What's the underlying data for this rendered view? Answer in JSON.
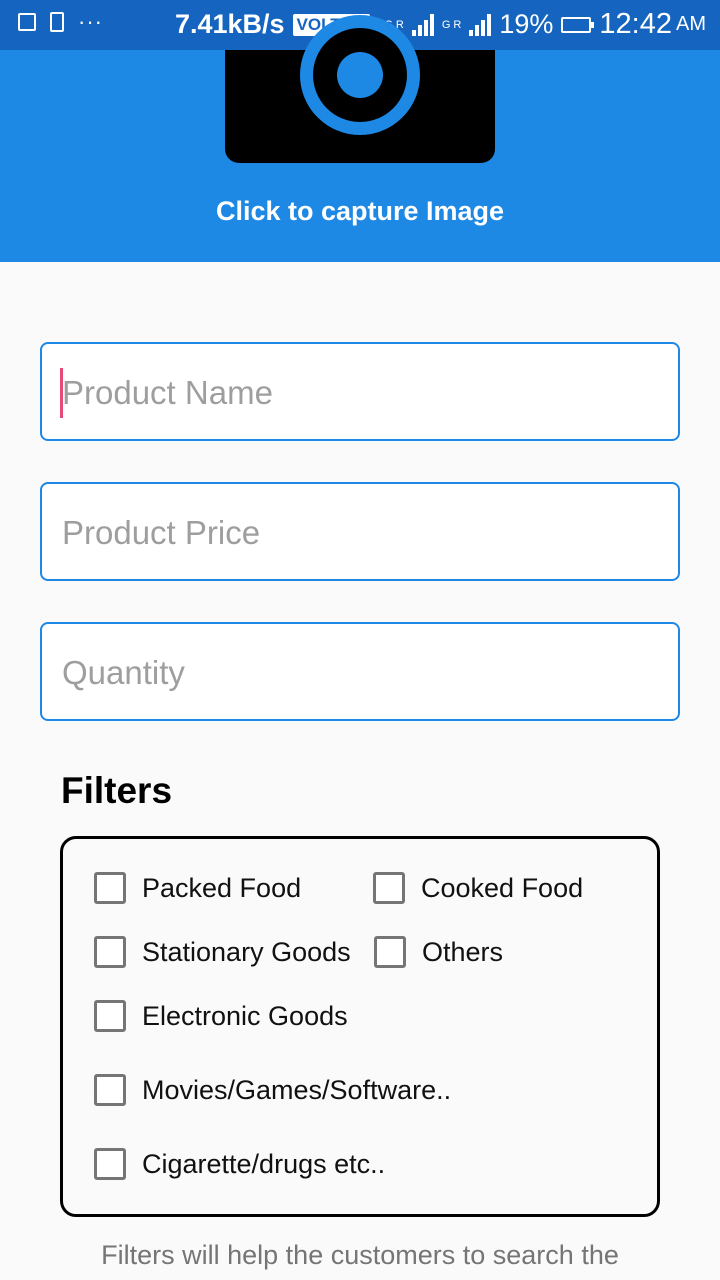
{
  "status_bar": {
    "speed": "7.41kB/s",
    "volte": "VOLTE 1",
    "net1": "4G R",
    "net2": "G R",
    "battery": "19%",
    "time": "12:42",
    "ampm": "AM"
  },
  "header": {
    "capture_label": "Click to capture Image"
  },
  "form": {
    "product_name": {
      "placeholder": "Product Name",
      "value": ""
    },
    "product_price": {
      "placeholder": "Product Price",
      "value": ""
    },
    "quantity": {
      "placeholder": "Quantity",
      "value": ""
    }
  },
  "filters": {
    "title": "Filters",
    "options": [
      {
        "label": "Packed Food",
        "checked": false
      },
      {
        "label": "Cooked Food",
        "checked": false
      },
      {
        "label": "Stationary Goods",
        "checked": false
      },
      {
        "label": "Others",
        "checked": false
      },
      {
        "label": "Electronic Goods",
        "checked": false
      },
      {
        "label": "Movies/Games/Software..",
        "checked": false
      },
      {
        "label": "Cigarette/drugs etc..",
        "checked": false
      }
    ]
  },
  "hint": "Filters will help the customers to search the"
}
